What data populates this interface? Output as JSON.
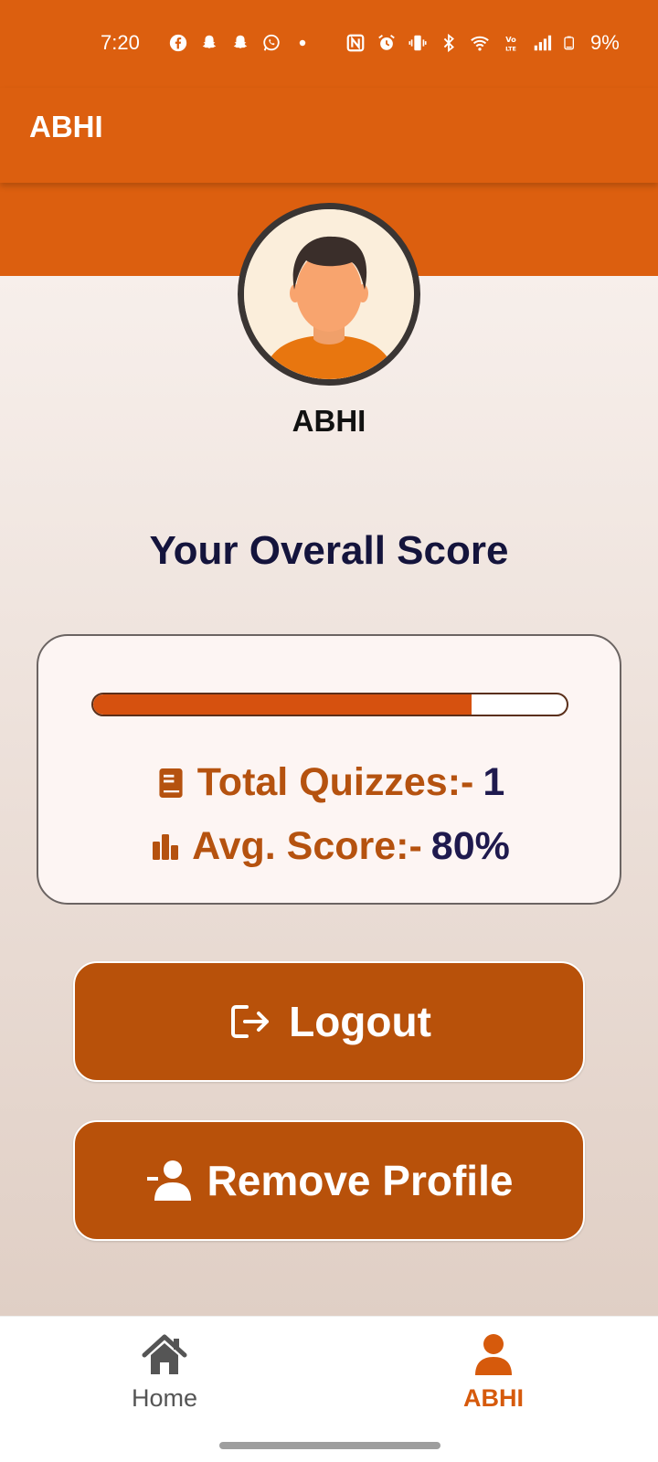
{
  "status_bar": {
    "time": "7:20",
    "battery_text": "9%",
    "left_icons": [
      "facebook-icon",
      "snapchat-icon",
      "snapchat-icon",
      "whatsapp-icon",
      "dot-icon"
    ],
    "right_icons": [
      "nfc-icon",
      "alarm-icon",
      "vibrate-icon",
      "bluetooth-icon",
      "wifi-icon",
      "volte-icon",
      "signal-icon",
      "battery-icon"
    ]
  },
  "app_bar": {
    "title": "ABHI"
  },
  "profile": {
    "name": "ABHI",
    "avatar_icon": "user-avatar-icon"
  },
  "score_section": {
    "heading": "Your Overall Score",
    "progress": 0.8,
    "total_quizzes_label": "Total Quizzes:-",
    "total_quizzes_value": "1",
    "avg_score_label": "Avg. Score:-",
    "avg_score_value": "80%"
  },
  "buttons": {
    "logout_label": "Logout",
    "remove_profile_label": "Remove Profile"
  },
  "bottom_nav": {
    "items": [
      {
        "label": "Home",
        "icon": "home-icon",
        "active": false
      },
      {
        "label": "ABHI",
        "icon": "person-icon",
        "active": true
      }
    ]
  },
  "colors": {
    "primary": "#DC5F0F",
    "button": "#B8510A",
    "progress_fill": "#D6510F",
    "heading_text": "#14143C",
    "accent_label": "#B5520F",
    "active_nav": "#D65A0C"
  }
}
